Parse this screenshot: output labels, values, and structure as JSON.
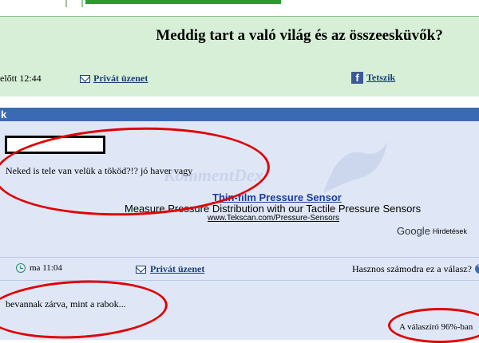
{
  "question": {
    "title": "Meddig tart a való világ és az összeesküvők?",
    "time": "előtt 12:44",
    "private_message": "Privát üzenet",
    "like": "Tetszik"
  },
  "answers_header": {
    "label": "k"
  },
  "answer1": {
    "text": "Neked is tele van velük a tököd?!? jó haver vagy",
    "watermark": "KommentDex",
    "ad": {
      "title": "Thin-film Pressure Sensor",
      "description": "Measure Pressure Distribution with our Tactile Pressure Sensors",
      "url": "www.Tekscan.com/Pressure-Sensors",
      "provider": "Google",
      "label": "Hirdetések"
    },
    "footer": {
      "time": "ma 11:04",
      "private_message": "Privát üzenet",
      "useful_question": "Hasznos számodra ez a válasz?",
      "help": "?"
    }
  },
  "answer2": {
    "text": "bevannak zárva, mint a rabok...",
    "respondent_percent": "A válaszíró 96%-ban"
  },
  "colors": {
    "question_bg": "#d7efd7",
    "answer_bg": "#dfe7f7",
    "header_blue": "#3a6ab4",
    "link": "#1a3d7a",
    "annotation_red": "#e00000"
  }
}
